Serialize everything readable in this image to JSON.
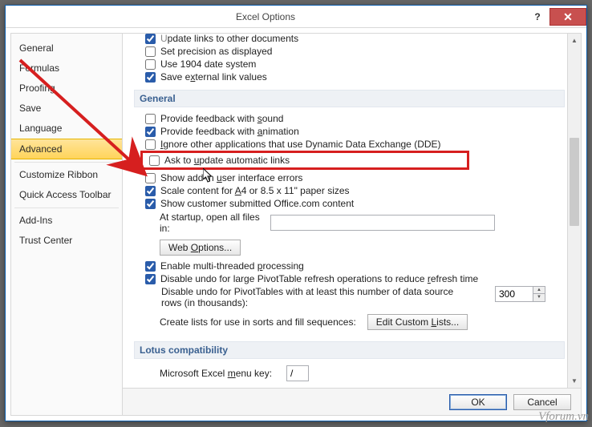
{
  "window": {
    "title": "Excel Options"
  },
  "sidebar": {
    "items": [
      {
        "label": "General"
      },
      {
        "label": "Formulas"
      },
      {
        "label": "Proofing"
      },
      {
        "label": "Save"
      },
      {
        "label": "Language"
      },
      {
        "label": "Advanced",
        "selected": true
      },
      {
        "label": "Customize Ribbon"
      },
      {
        "label": "Quick Access Toolbar"
      },
      {
        "label": "Add-Ins"
      },
      {
        "label": "Trust Center"
      }
    ]
  },
  "top_group": {
    "update_links_other_docs": "Update links to other documents",
    "set_precision": "Set precision as displayed",
    "use_1904": "Use 1904 date system",
    "save_external": "Save external link values"
  },
  "general": {
    "heading": "General",
    "feedback_sound": "Provide feedback with sound",
    "feedback_animation": "Provide feedback with animation",
    "ignore_dde": "Ignore other applications that use Dynamic Data Exchange (DDE)",
    "ask_update_links": "Ask to update automatic links",
    "show_addin_errors": "Show add-in user interface errors",
    "scale_a4": "Scale content for A4 or 8.5 x 11\" paper sizes",
    "show_customer_office": "Show customer submitted Office.com content",
    "startup_label": "At startup, open all files in:",
    "startup_value": "",
    "web_options_btn": "Web Options...",
    "enable_multi": "Enable multi-threaded processing",
    "disable_undo_pivot": "Disable undo for large PivotTable refresh operations to reduce refresh time",
    "disable_undo_rows_label": "Disable undo for PivotTables with at least this number of data source rows (in thousands):",
    "disable_undo_rows_value": "300",
    "create_lists_label": "Create lists for use in sorts and fill sequences:",
    "edit_custom_lists_btn": "Edit Custom Lists..."
  },
  "lotus": {
    "heading": "Lotus compatibility",
    "menu_key_label": "Microsoft Excel menu key:",
    "menu_key_value": "/"
  },
  "buttons": {
    "ok": "OK",
    "cancel": "Cancel"
  },
  "watermark": "Vforum.vn"
}
